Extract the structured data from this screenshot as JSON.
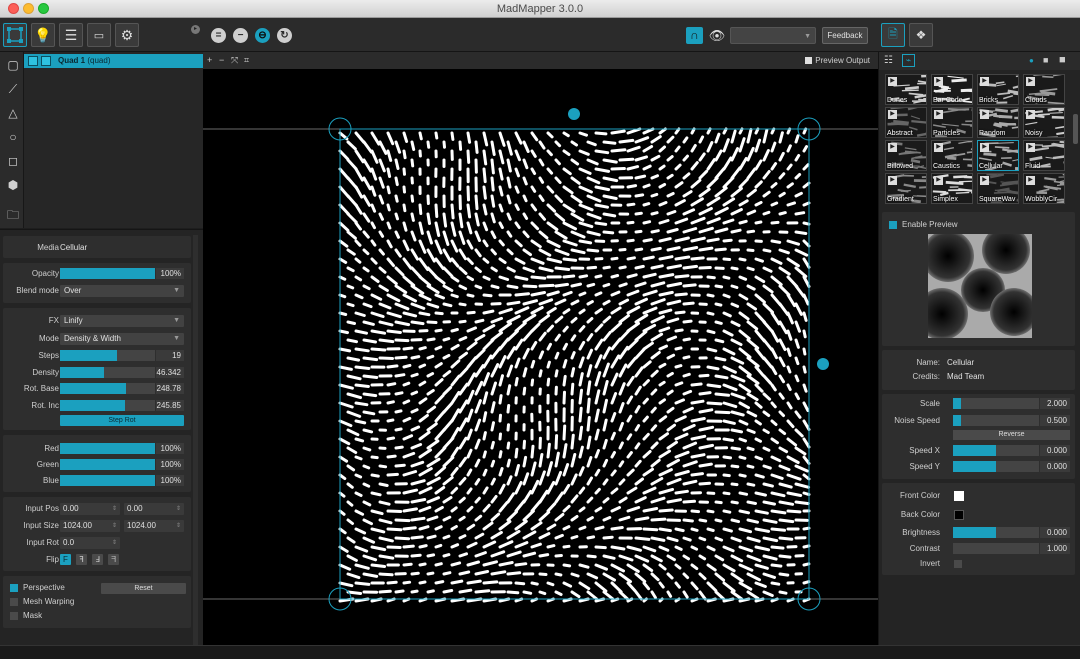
{
  "window": {
    "title": "MadMapper 3.0.0"
  },
  "toolbar": {
    "left_icons": [
      "surface-icon",
      "bulb-icon",
      "list-icon",
      "projector-icon",
      "gear-icon"
    ],
    "mode_buttons": [
      "=",
      "−",
      "⊖",
      "↻"
    ],
    "magnet_label": "∩",
    "feedback_label": "Feedback"
  },
  "tools": [
    "quad-tool-icon",
    "line-tool-icon",
    "triangle-tool-icon",
    "circle-tool-icon",
    "mesh-tool-icon",
    "3d-object-icon",
    "folder-add-icon"
  ],
  "surfaces": [
    {
      "name": "Quad 1",
      "type": "(quad)"
    }
  ],
  "canvas": {
    "preview_output_label": "Preview Output"
  },
  "media_section": {
    "label": "Media",
    "value": "Cellular"
  },
  "opacity": {
    "label": "Opacity",
    "value": "100%",
    "fraction": 1.0
  },
  "blend": {
    "label": "Blend mode",
    "value": "Over"
  },
  "fx": {
    "fx_label": "FX",
    "fx_value": "Linify",
    "mode_label": "Mode",
    "mode_value": "Density & Width",
    "steps": {
      "label": "Steps",
      "value": "19",
      "fraction": 0.6
    },
    "density": {
      "label": "Density",
      "value": "46.342",
      "fraction": 0.46
    },
    "rot_base": {
      "label": "Rot. Base",
      "value": "248.78",
      "fraction": 0.69
    },
    "rot_inc": {
      "label": "Rot. Inc",
      "value": "245.85",
      "fraction": 0.68
    },
    "step_rot_label": "Step Rot"
  },
  "colors": {
    "red": {
      "label": "Red",
      "value": "100%",
      "fraction": 1.0
    },
    "green": {
      "label": "Green",
      "value": "100%",
      "fraction": 1.0
    },
    "blue": {
      "label": "Blue",
      "value": "100%",
      "fraction": 1.0
    }
  },
  "input": {
    "pos_label": "Input Pos",
    "pos_x": "0.00",
    "pos_y": "0.00",
    "size_label": "Input Size",
    "size_x": "1024.00",
    "size_y": "1024.00",
    "rot_label": "Input Rot",
    "rot": "0.0",
    "flip_label": "Flip",
    "flip_buttons": [
      "F",
      "ꟻ",
      "Ⅎ",
      "ᖷ"
    ]
  },
  "warping": {
    "perspective": "Perspective",
    "reset": "Reset",
    "mesh": "Mesh Warping",
    "mask": "Mask"
  },
  "library": {
    "thumbs": [
      {
        "name": "Dunes"
      },
      {
        "name": "Bar Code"
      },
      {
        "name": "Bricks"
      },
      {
        "name": "Clouds"
      },
      {
        "name": "Abstract"
      },
      {
        "name": "Particles"
      },
      {
        "name": "Random"
      },
      {
        "name": "Noisy"
      },
      {
        "name": "Billowed"
      },
      {
        "name": "Caustics"
      },
      {
        "name": "Cellular"
      },
      {
        "name": "Fluid"
      },
      {
        "name": "Gradient"
      },
      {
        "name": "Simplex"
      },
      {
        "name": "SquareWav"
      },
      {
        "name": "WobblyCir"
      }
    ],
    "selected": "Cellular"
  },
  "preview": {
    "enable_label": "Enable Preview"
  },
  "info": {
    "name_label": "Name:",
    "name_value": "Cellular",
    "credits_label": "Credits:",
    "credits_value": "Mad Team"
  },
  "params": {
    "scale": {
      "label": "Scale",
      "value": "2.000",
      "fraction": 0.09
    },
    "noise_speed": {
      "label": "Noise Speed",
      "value": "0.500",
      "fraction": 0.09
    },
    "reverse_label": "Reverse",
    "speed_x": {
      "label": "Speed X",
      "value": "0.000",
      "fraction": 0.5
    },
    "speed_y": {
      "label": "Speed Y",
      "value": "0.000",
      "fraction": 0.5
    }
  },
  "color_params": {
    "front_label": "Front Color",
    "front_color": "#ffffff",
    "back_label": "Back Color",
    "back_color": "#000000",
    "brightness": {
      "label": "Brightness",
      "value": "0.000",
      "fraction": 0.5
    },
    "contrast": {
      "label": "Contrast",
      "value": "1.000",
      "fraction": 0.0
    },
    "invert_label": "Invert"
  },
  "accent_color": "#1ba0bf"
}
